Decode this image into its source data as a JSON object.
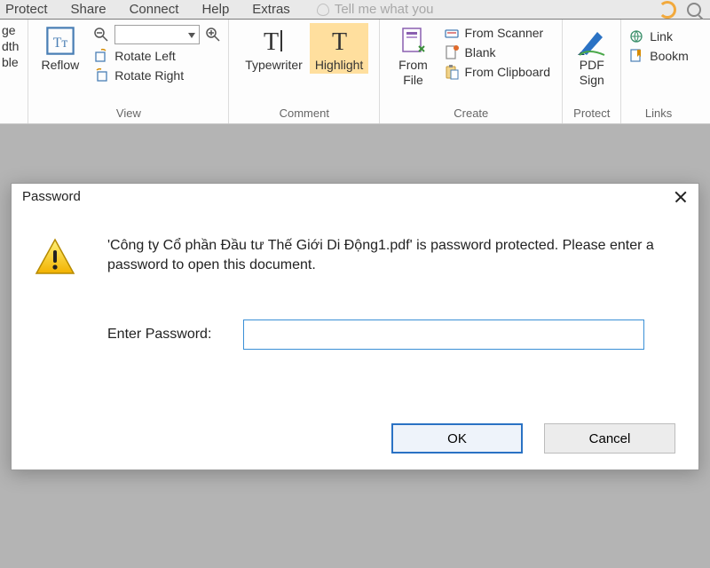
{
  "menu": {
    "items": [
      "Protect",
      "Share",
      "Connect",
      "Help",
      "Extras"
    ],
    "tellme": "Tell me what you"
  },
  "left_cut": {
    "l1": "ge",
    "l2": "dth",
    "l3": "ble"
  },
  "ribbon": {
    "view": {
      "label": "View",
      "reflow": "Reflow",
      "rotate_left": "Rotate Left",
      "rotate_right": "Rotate Right"
    },
    "comment": {
      "label": "Comment",
      "typewriter": "Typewriter",
      "highlight": "Highlight"
    },
    "create": {
      "label": "Create",
      "from_file": {
        "l1": "From",
        "l2": "File"
      },
      "scanner": "From Scanner",
      "blank": "Blank",
      "clipboard": "From Clipboard"
    },
    "protect": {
      "label": "Protect",
      "pdf_sign": {
        "l1": "PDF",
        "l2": "Sign"
      }
    },
    "links": {
      "label": "Links",
      "link": "Link",
      "bookmark": "Bookm"
    }
  },
  "dialog": {
    "title": "Password",
    "message": "'Công ty Cổ phần Đầu tư Thế Giới Di Động1.pdf' is password protected. Please enter a password to open this document.",
    "field_label": "Enter Password:",
    "value": "",
    "ok": "OK",
    "cancel": "Cancel"
  }
}
